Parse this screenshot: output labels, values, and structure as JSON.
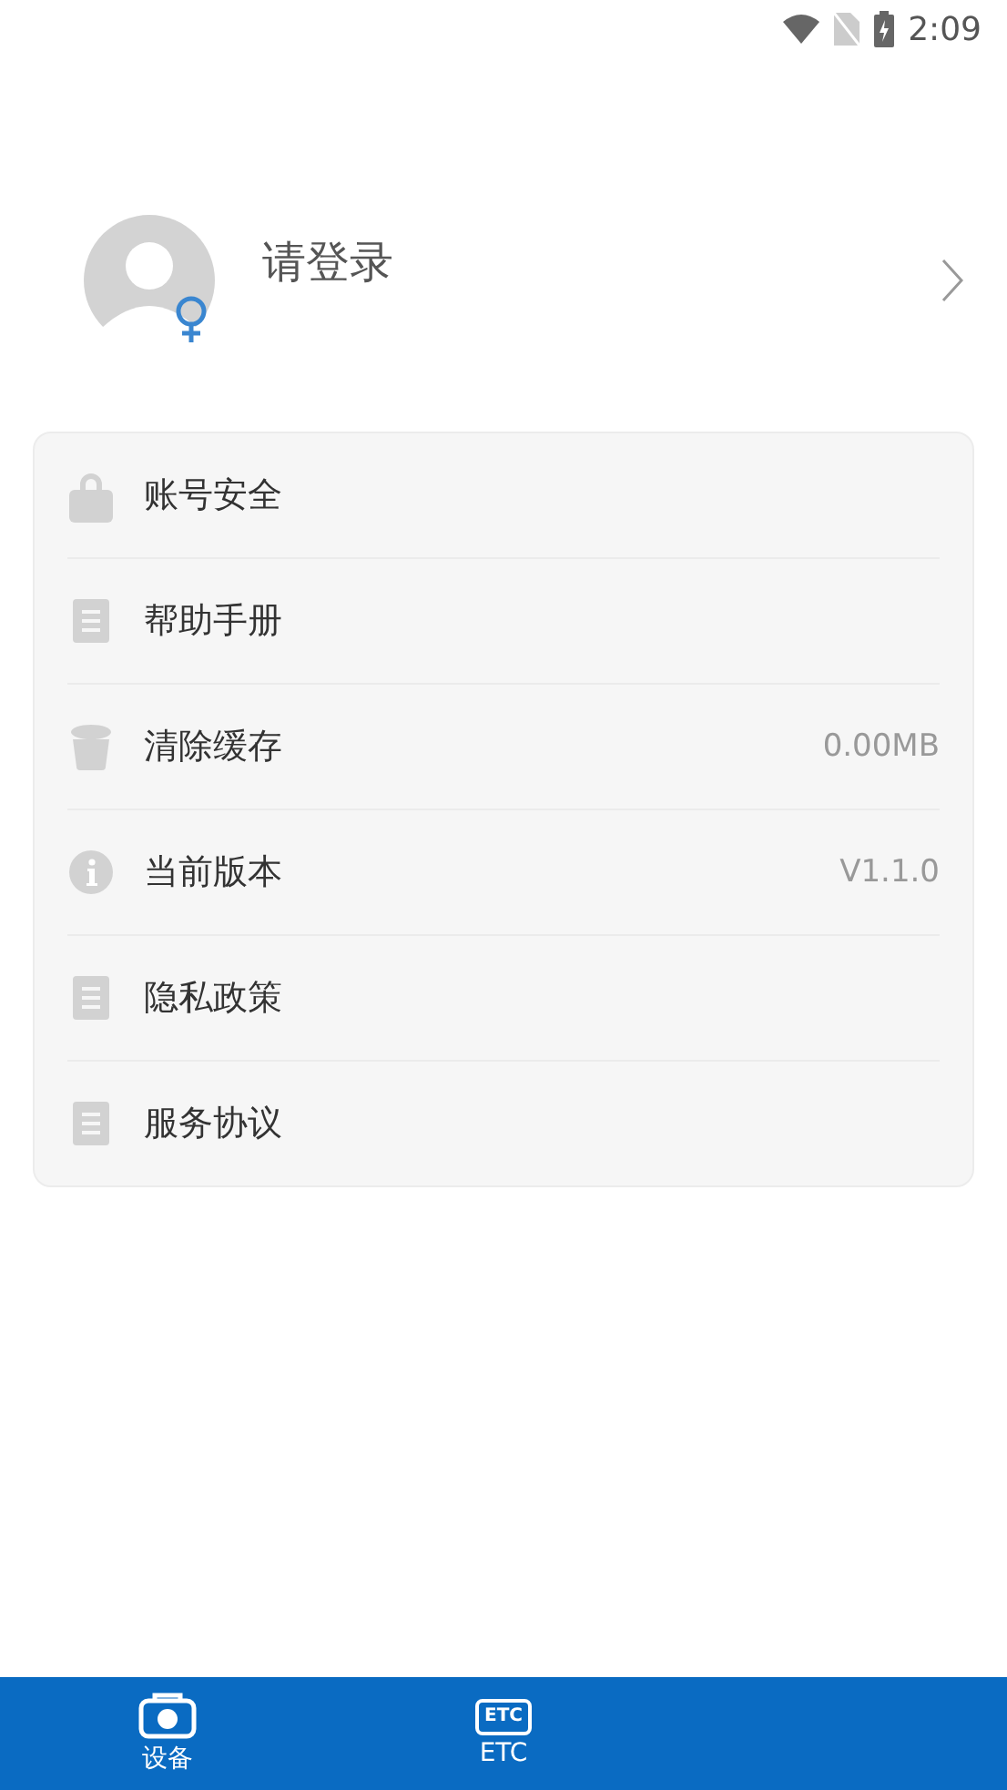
{
  "status_bar": {
    "time": "2:09"
  },
  "profile": {
    "name": "请登录"
  },
  "menu": [
    {
      "kind": "lock",
      "label": "账号安全"
    },
    {
      "kind": "doc",
      "label": "帮助手册"
    },
    {
      "kind": "trash",
      "label": "清除缓存",
      "value": "0.00MB"
    },
    {
      "kind": "info",
      "label": "当前版本",
      "value": "V1.1.0"
    },
    {
      "kind": "doc",
      "label": "隐私政策"
    },
    {
      "kind": "doc",
      "label": "服务协议"
    }
  ],
  "bottom_nav": [
    {
      "kind": "camera",
      "label": "设备"
    },
    {
      "kind": "etc",
      "label": "ETC",
      "icon_text": "ETC"
    }
  ]
}
